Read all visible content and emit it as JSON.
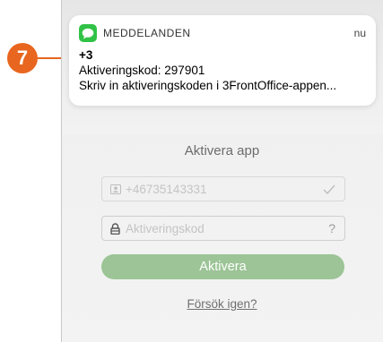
{
  "callout": {
    "number": "7",
    "color": "#e8661f"
  },
  "notification": {
    "app_name": "MEDDELANDEN",
    "time": "nu",
    "sender": "+3",
    "line1": "Aktiveringskod: 297901",
    "line2": "Skriv in aktiveringskoden i 3FrontOffice-appen...",
    "app_icon": "messages-icon",
    "app_icon_color": "#30c246"
  },
  "form": {
    "title": "Aktivera app",
    "phone_field": {
      "value": "+46735143331",
      "icon": "contact-card-icon",
      "trailing_icon": "checkmark-icon"
    },
    "code_field": {
      "placeholder": "Aktiveringskod",
      "icon": "lock-icon",
      "help": "?"
    },
    "activate_button": "Aktivera",
    "retry_link": "Försök igen?",
    "button_color": "#9cc496"
  }
}
